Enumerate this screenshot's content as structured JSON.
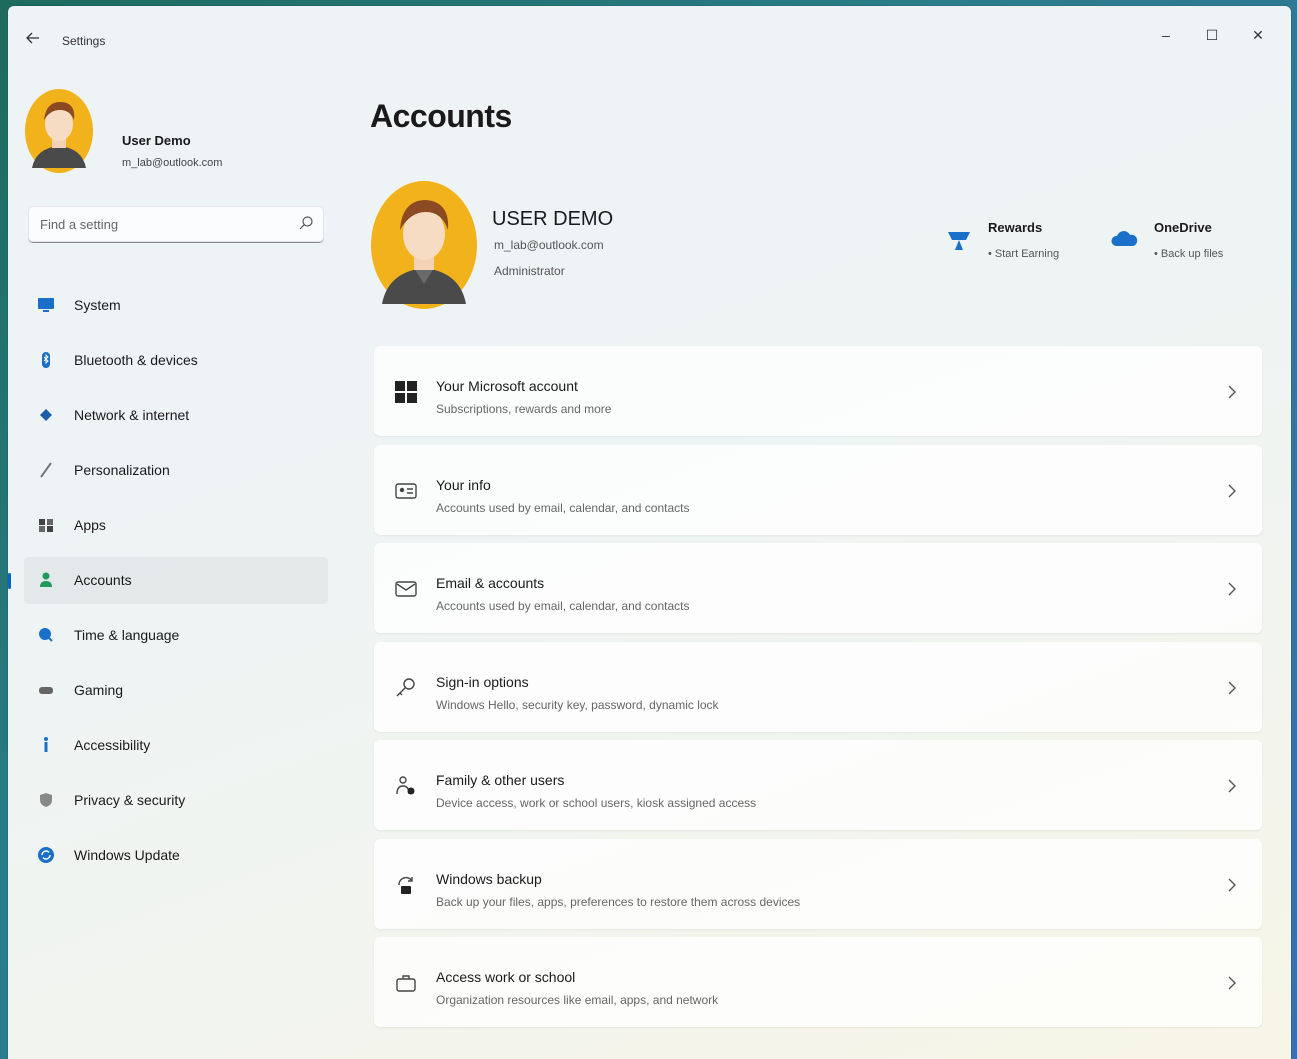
{
  "window": {
    "title": "Settings",
    "controls": {
      "minimize": "–",
      "maximize": "☐",
      "close": "✕"
    }
  },
  "sidebar": {
    "profile": {
      "name": "User Demo",
      "email": "m_lab@outlook.com"
    },
    "search": {
      "placeholder": "Find a setting",
      "icon": "search-icon"
    },
    "items": [
      {
        "label": "System",
        "icon": "monitor-icon",
        "color": "#1a6fc9"
      },
      {
        "label": "Bluetooth & devices",
        "icon": "bluetooth-icon",
        "color": "#1a6fc9"
      },
      {
        "label": "Network & internet",
        "icon": "wifi-icon",
        "color": "#1a5fa8"
      },
      {
        "label": "Personalization",
        "icon": "brush-icon",
        "color": "#777777"
      },
      {
        "label": "Apps",
        "icon": "apps-icon",
        "color": "#444444"
      },
      {
        "label": "Accounts",
        "icon": "person-icon",
        "color": "#1f9a5b",
        "active": true
      },
      {
        "label": "Time & language",
        "icon": "globe-clock-icon",
        "color": "#1a6fc9"
      },
      {
        "label": "Gaming",
        "icon": "gamepad-icon",
        "color": "#666666"
      },
      {
        "label": "Accessibility",
        "icon": "accessibility-icon",
        "color": "#1a6fc9"
      },
      {
        "label": "Privacy & security",
        "icon": "shield-icon",
        "color": "#777777"
      },
      {
        "label": "Windows Update",
        "icon": "update-icon",
        "color": "#1a6fc9"
      }
    ]
  },
  "main": {
    "title": "Accounts",
    "hero": {
      "name": "USER DEMO",
      "email": "m_lab@outlook.com",
      "role": "Administrator"
    },
    "promos": [
      {
        "title": "Rewards",
        "sub": "• Start Earning",
        "icon": "rewards-icon",
        "color": "#1a6fc9"
      },
      {
        "title": "OneDrive",
        "sub": "• Back up files",
        "icon": "cloud-icon",
        "color": "#1a6fc9"
      }
    ],
    "cards": [
      {
        "title": "Your Microsoft account",
        "sub": "Subscriptions, rewards and more",
        "icon": "microsoft-logo-icon"
      },
      {
        "title": "Your info",
        "sub": "Accounts used by email, calendar, and contacts",
        "icon": "contact-card-icon"
      },
      {
        "title": "Email & accounts",
        "sub": "Accounts used by email, calendar, and contacts",
        "icon": "mail-icon"
      },
      {
        "title": "Sign-in options",
        "sub": "Windows Hello, security key, password, dynamic lock",
        "icon": "key-icon"
      },
      {
        "title": "Family & other users",
        "sub": "Device access, work or school users, kiosk assigned access",
        "icon": "family-icon"
      },
      {
        "title": "Windows backup",
        "sub": "Back up your files, apps, preferences to restore them across devices",
        "icon": "backup-icon"
      },
      {
        "title": "Access work or school",
        "sub": "Organization resources like email, apps, and network",
        "icon": "briefcase-icon"
      }
    ]
  }
}
